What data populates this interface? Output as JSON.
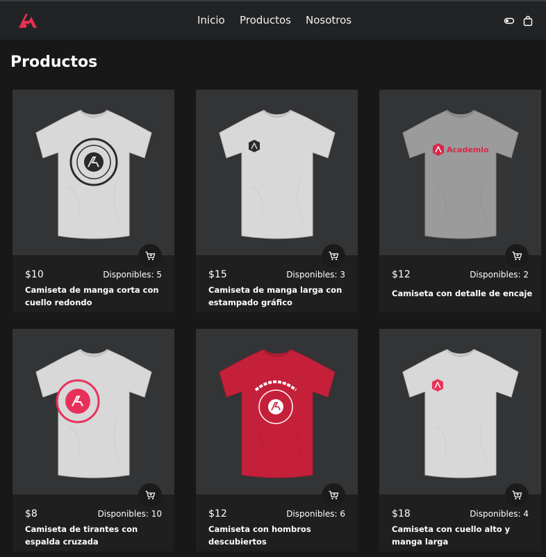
{
  "header": {
    "logo": "academlo-logo",
    "nav": [
      "Inicio",
      "Productos",
      "Nosotros"
    ],
    "icons": [
      "theme-toggle-icon",
      "shopping-bag-icon"
    ],
    "accent": "#e8314f"
  },
  "page": {
    "title": "Productos"
  },
  "products": [
    {
      "price": "$10",
      "stock": "Disponibles: 5",
      "name": "Camiseta de manga corta con cuello redondo",
      "shirt_color": "#d8d8d8",
      "print": "round-seal-dark"
    },
    {
      "price": "$15",
      "stock": "Disponibles: 3",
      "name": "Camiseta de manga larga con estampado gráfico",
      "shirt_color": "#d8d8d8",
      "print": "small-hex-dark"
    },
    {
      "price": "$12",
      "stock": "Disponibles: 2",
      "name": "Camiseta con detalle de encaje",
      "shirt_color": "#9b9b9b",
      "print": "Academlo wordmark"
    },
    {
      "price": "$8",
      "stock": "Disponibles: 10",
      "name": "Camiseta de tirantes con espalda cruzada",
      "shirt_color": "#d8d8d8",
      "print": "round-seal-red"
    },
    {
      "price": "$12",
      "stock": "Disponibles: 6",
      "name": "Camiseta con hombros descubiertos",
      "shirt_color": "#c5203a",
      "print": "college-seal-white"
    },
    {
      "price": "$18",
      "stock": "Disponibles: 4",
      "name": "Camiseta con cuello alto y manga larga",
      "shirt_color": "#d8d8d8",
      "print": "small-hex-red"
    }
  ],
  "card_icon": "add-to-cart-icon"
}
